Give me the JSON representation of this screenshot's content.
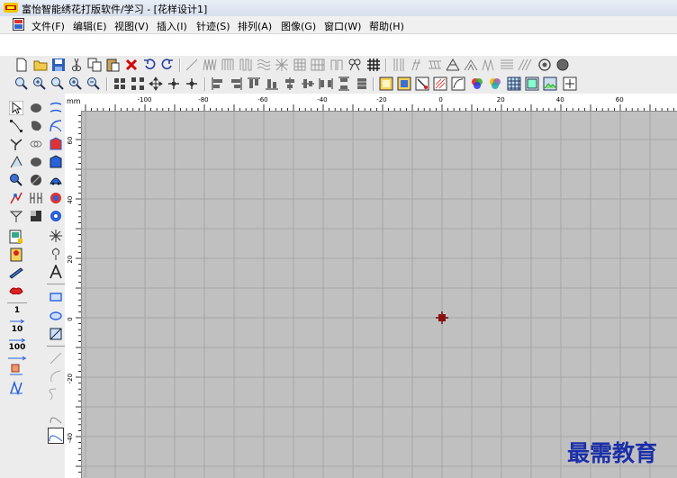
{
  "window": {
    "title": "富怡智能绣花打版软件/学习 - [花样设计1]"
  },
  "menu": [
    {
      "label": "文件(F)"
    },
    {
      "label": "编辑(E)"
    },
    {
      "label": "视图(V)"
    },
    {
      "label": "插入(I)"
    },
    {
      "label": "针迹(S)"
    },
    {
      "label": "排列(A)"
    },
    {
      "label": "图像(G)"
    },
    {
      "label": "窗口(W)"
    },
    {
      "label": "帮助(H)"
    }
  ],
  "ruler": {
    "unit": "mm",
    "top_ticks": [
      "-100",
      "-80",
      "-60",
      "-40",
      "-20",
      "0",
      "20",
      "40",
      "60"
    ],
    "left_ticks": [
      "60",
      "40",
      "20",
      "0",
      "-20",
      "-40"
    ]
  },
  "left_tools": {
    "counters": [
      "1",
      "10",
      "100"
    ]
  },
  "colors": {
    "canvas": "#c0c0c0",
    "grid": "#a6a6a6",
    "origin_marker": "#8b1010",
    "watermark": "#1b2fa8"
  },
  "watermark": "最需教育"
}
